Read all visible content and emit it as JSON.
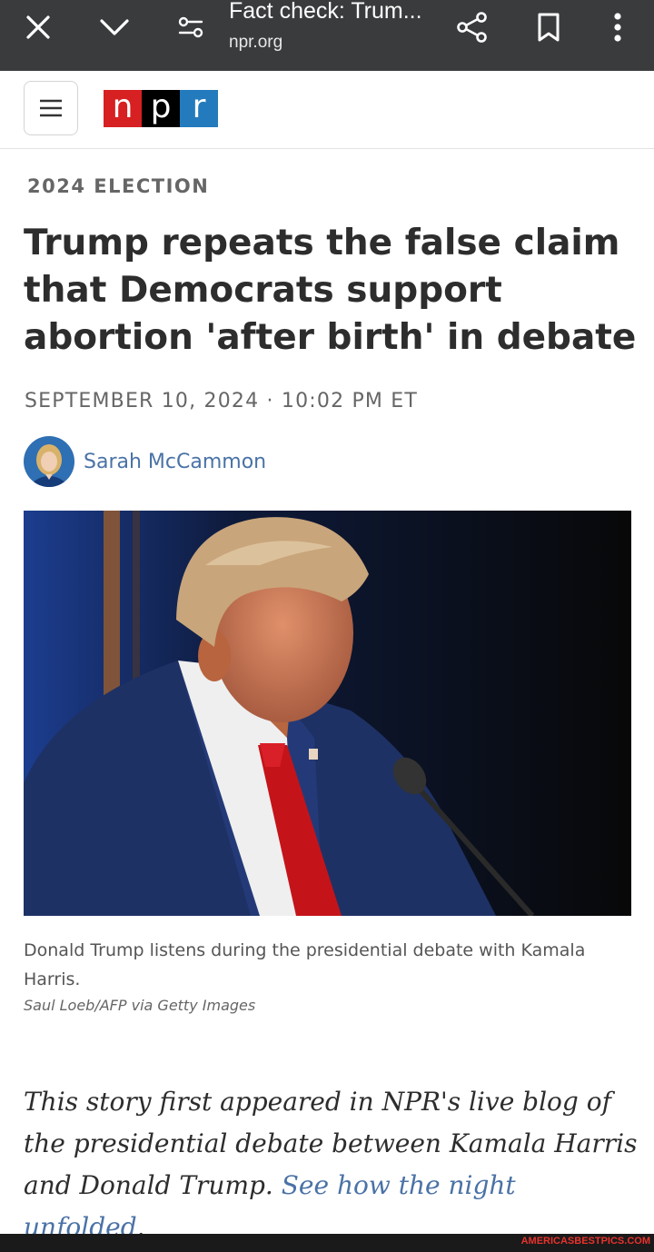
{
  "browser": {
    "title": "Fact check: Trum...",
    "domain": "npr.org",
    "icons": [
      "close-icon",
      "chevron-down-icon",
      "page-settings-icon",
      "share-icon",
      "bookmark-icon",
      "more-vert-icon"
    ]
  },
  "site": {
    "logo_letters": [
      "n",
      "p",
      "r"
    ],
    "brand_colors": {
      "n": "#d62021",
      "p": "#000000",
      "r": "#237bbd"
    }
  },
  "article": {
    "kicker": "2024 ELECTION",
    "headline": "Trump repeats the false claim that Democrats support abortion 'after birth' in debate",
    "dateline": "SEPTEMBER 10, 2024 · 10:02 PM ET",
    "author": "Sarah McCammon",
    "photo_caption": "Donald Trump listens during the presidential debate with Kamala Harris.",
    "photo_credit": "Saul Loeb/AFP via Getty Images",
    "note_text": "This story first appeared in NPR's live blog of the presidential debate between Kamala Harris and Donald Trump.",
    "note_link": "See how the night unfolded",
    "note_end": "."
  },
  "footer": {
    "watermark": "AMERICASBESTPICS.COM"
  }
}
